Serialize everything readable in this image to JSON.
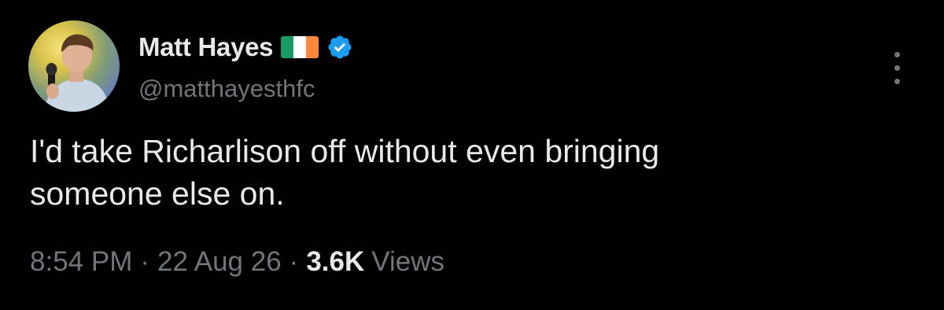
{
  "tweet": {
    "author": {
      "display_name": "Matt Hayes",
      "handle": "@matthayesthfc",
      "flag_icon": "ireland-flag-icon",
      "verified_icon": "verified-badge-icon",
      "avatar": "user-avatar"
    },
    "text_lines": [
      "I'd take Richarlison off without even bringing",
      "someone else on."
    ],
    "meta": {
      "time": "8:54 PM",
      "separator": "·",
      "date": "22 Aug 26",
      "views_count": "3.6K",
      "views_label": "Views"
    },
    "more_icon": "more-vertical-icon"
  },
  "colors": {
    "background": "#000000",
    "text_primary": "#e7e9ea",
    "text_secondary": "#71767b",
    "verified_blue": "#1d9bf0",
    "flag_green": "#169b62",
    "flag_white": "#ffffff",
    "flag_orange": "#ff883e"
  }
}
